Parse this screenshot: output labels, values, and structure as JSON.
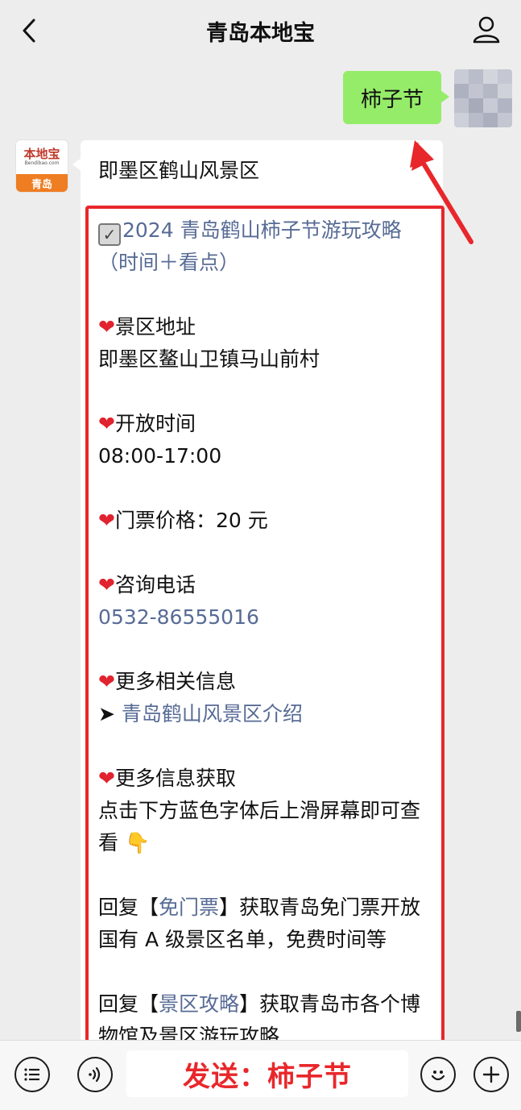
{
  "header": {
    "title": "青岛本地宝"
  },
  "user_message": {
    "text": "柿子节"
  },
  "bot": {
    "avatar": {
      "brand": "本地宝",
      "sub": "Bendibao.com",
      "city": "青岛"
    },
    "intro": "即墨区鹤山风景区",
    "guide_link": "2024 青岛鹤山柿子节游玩攻略（时间＋看点）",
    "sections": {
      "address_title": "景区地址",
      "address": "即墨区鳌山卫镇马山前村",
      "hours_title": "开放时间",
      "hours": "08:00-17:00",
      "price": "门票价格：20 元",
      "phone_title": "咨询电话",
      "phone": "0532-86555016",
      "more_title": "更多相关信息",
      "more_link": "青岛鹤山风景区介绍",
      "get_more_title": "更多信息获取",
      "get_more_text": "点击下方蓝色字体后上滑屏幕即可查看",
      "reply1_prefix": "回复【",
      "reply1_link": "免门票",
      "reply1_suffix": "】获取青岛免门票开放国有 A 级景区名单，免费时间等",
      "reply2_prefix": "回复【",
      "reply2_link": "景区攻略",
      "reply2_suffix": "】获取青岛市各个博物馆及景区游玩攻略"
    }
  },
  "input": {
    "annotation": "发送：柿子节"
  },
  "colors": {
    "bubble_green": "#95ec69",
    "link_blue": "#576b95",
    "annotation_red": "#e8272b",
    "heart_red": "#e0232e"
  },
  "icons": [
    "back-icon",
    "profile-icon",
    "voice-list-icon",
    "voice-icon",
    "emoji-icon",
    "plus-icon",
    "heart-icon",
    "check-icon",
    "pointing-down-icon"
  ]
}
